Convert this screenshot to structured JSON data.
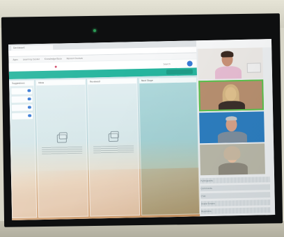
{
  "browser": {
    "tab_title": "Dashboard",
    "url": "",
    "bookmarks": [
      "Apps",
      "Learning Center",
      "Knowledge Base",
      "Recent Courses"
    ]
  },
  "app": {
    "search_placeholder": "Search",
    "accent_color": "#26b59e"
  },
  "board": {
    "columns": [
      {
        "title": "Suggestions"
      },
      {
        "title": "Ideas"
      },
      {
        "title": "Reviewed"
      },
      {
        "title": "Next Stage"
      }
    ],
    "empty_state_label": ""
  },
  "participants": [
    {
      "name": ""
    },
    {
      "name": ""
    },
    {
      "name": ""
    },
    {
      "name": ""
    }
  ],
  "side_list": {
    "items": [
      "Participants",
      "Comments",
      "Chat",
      "Share Screen",
      "Reactions"
    ]
  }
}
